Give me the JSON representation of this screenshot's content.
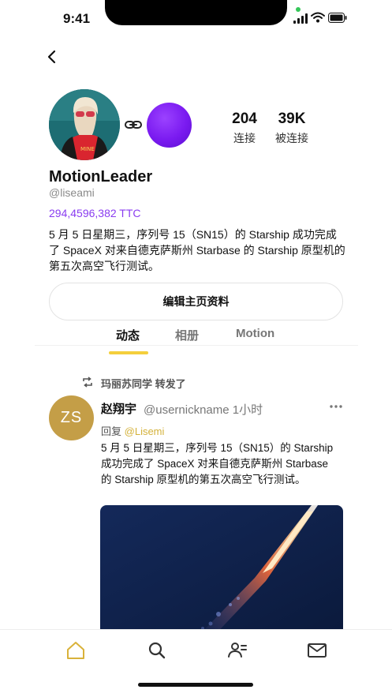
{
  "status_bar": {
    "time": "9:41"
  },
  "profile": {
    "display_name": "MotionLeader",
    "handle": "@liseami",
    "balance": "294,4596,382 TTC",
    "bio": "5 月 5 日星期三，序列号 15（SN15）的 Starship 成功完成了 SpaceX 对来自德克萨斯州 Starbase 的 Starship 原型机的第五次高空飞行测试。",
    "stats": [
      {
        "value": "204",
        "label": "连接"
      },
      {
        "value": "39K",
        "label": "被连接"
      }
    ],
    "edit_button": "编辑主页资料"
  },
  "tabs": [
    {
      "label": "动态",
      "active": true
    },
    {
      "label": "相册",
      "active": false
    },
    {
      "label": "Motion",
      "active": false
    }
  ],
  "post": {
    "repost_text": "玛丽苏同学 转发了",
    "avatar_initials": "ZS",
    "author": "赵翔宇",
    "meta": "@usernickname 1小时",
    "reply_prefix": "回复",
    "reply_to": "@Lisemi",
    "text": "5 月 5 日星期三，序列号 15（SN15）的 Starship 成功完成了 SpaceX 对来自德克萨斯州 Starbase 的 Starship 原型机的第五次高空飞行测试。"
  },
  "icons": {
    "back": "chevron-left-icon",
    "link": "link-icon",
    "repost": "repost-icon",
    "more": "more-dots-icon",
    "nav": [
      "home-icon",
      "search-icon",
      "people-icon",
      "mail-icon"
    ]
  },
  "colors": {
    "accent": "#f4cf3c",
    "balance": "#8a3df0",
    "post_avatar": "#c49e47",
    "linked_avatar": "#7a1af0"
  }
}
